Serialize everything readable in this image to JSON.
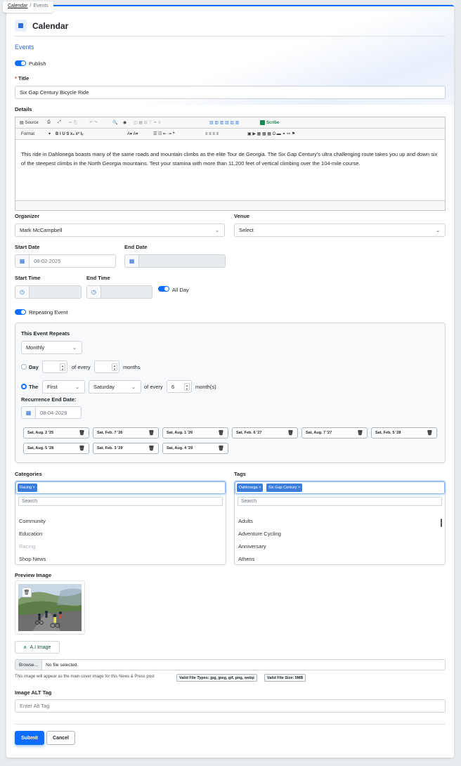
{
  "breadcrumb": {
    "root": "Calendar",
    "current": "Events"
  },
  "page_title": "Calendar",
  "section_title": "Events",
  "publish_label": "Publish",
  "title_label": "Title",
  "title_required_mark": "*",
  "title_value": "Six Gap Century Bicycle Ride",
  "details_label": "Details",
  "toolbar": {
    "source": "Source",
    "scribe": "Scribe",
    "format": "Format"
  },
  "details_text": "This ride in Dahlonega boasts many of the same roads and mountain climbs as the elite Tour de Georgia. The Six Gap Century's ultra challenging route takes you up and down six of the steepest climbs in the North Georgia mountains. Test your stamina with more than 11,200 feet of vertical climbing over the 104-mile course.",
  "organizer": {
    "label": "Organizer",
    "value": "Mark McCampbell"
  },
  "venue": {
    "label": "Venue",
    "value": "Select"
  },
  "start_date": {
    "label": "Start Date",
    "value": "08-02-2025"
  },
  "end_date": {
    "label": "End Date",
    "value": ""
  },
  "start_time": {
    "label": "Start Time"
  },
  "end_time": {
    "label": "End Time"
  },
  "all_day_label": "All Day",
  "repeating_label": "Repeating Event",
  "repeat": {
    "title": "This Event Repeats",
    "frequency": "Monthly",
    "day_label": "Day",
    "of_every": "of every",
    "months": "months",
    "the_label": "The",
    "ordinal": "First",
    "weekday": "Saturday",
    "interval": "6",
    "months_paren": "month(s)",
    "end_label": "Recurrence End Date:",
    "end_value": "08-04-2029",
    "dates": [
      "Sat, Aug. 2 '25",
      "Sat, Feb. 7 '26",
      "Sat, Aug. 1 '26",
      "Sat, Feb. 6 '27",
      "Sat, Aug. 7 '27",
      "Sat, Feb. 5 '28",
      "Sat, Aug. 5 '28",
      "Sat, Feb. 3 '29",
      "Sat, Aug. 4 '29"
    ]
  },
  "categories": {
    "label": "Categories",
    "selected": [
      "Racing"
    ],
    "search_placeholder": "Search",
    "items": [
      "Community",
      "Education",
      "Racing",
      "Shop News"
    ]
  },
  "tags": {
    "label": "Tags",
    "selected": [
      "Dahlonega",
      "Six Gap Century"
    ],
    "search_placeholder": "Search",
    "items": [
      "Adults",
      "Adventure Cycling",
      "Anniversary",
      "Athens"
    ]
  },
  "preview_label": "Preview Image",
  "ai_image_label": "A.I Image",
  "file": {
    "browse": "Browse...",
    "status": "No file selected."
  },
  "help_text": "This image will appear as the main cover image for this News & Press post",
  "valid_types": "Valid File Types: jpg, jpeg, gif, png, webp",
  "valid_size": "Valid File Size: 5MB",
  "alt_label": "Image ALT Tag",
  "alt_placeholder": "Enter Alt Tag",
  "submit_label": "Submit",
  "cancel_label": "Cancel",
  "colors": {
    "primary": "#0d6efd",
    "accent_text": "#2b6cd6",
    "scribe": "#198754"
  }
}
